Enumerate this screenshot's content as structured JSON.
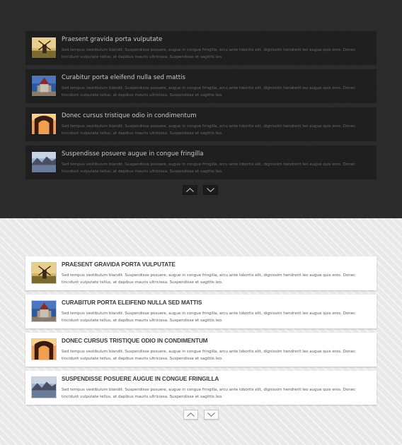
{
  "dark_list": {
    "items": [
      {
        "title": "Praesent gravida porta vulputate",
        "description": "Sed tempus vestibulum blandit. Suspendisse posuere, augue in congue fringilla, arcu ante lobortis elit, dignissim hendrerit leo augue quis eros. Donec tincidunt vulputate tellus, at dapibus mauris ultriciesa. Suspendisse et sagittis leo.",
        "image": "windmill"
      },
      {
        "title": "Curabitur porta eleifend nulla sed mattis",
        "description": "Sed tempus vestibulum blandit. Suspendisse posuere, augue in congue fringilla, arcu ante lobortis elit, dignissim hendrerit leo augue quis eros. Donec tincidunt vulputate tellus, at dapibus mauris ultriciesa. Suspendisse et sagittis leo.",
        "image": "castle"
      },
      {
        "title": "Donec cursus tristique odio in condimentum",
        "description": "Sed tempus vestibulum blandit. Suspendisse posuere, augue in congue fringilla, arcu ante lobortis elit, dignissim hendrerit leo augue quis eros. Donec tincidunt vulputate tellus, at dapibus mauris ultriciesa. Suspendisse et sagittis leo.",
        "image": "arch"
      },
      {
        "title": "Suspendisse posuere augue in congue fringilla",
        "description": "Sed tempus vestibulum blandit. Suspendisse posuere, augue in congue fringilla, arcu ante lobortis elit, dignissim hendrerit leo augue quis eros. Donec tincidunt vulputate tellus, at dapibus mauris ultriciesa. Suspendisse et sagittis leo.",
        "image": "lake"
      }
    ],
    "nav": {
      "up_icon": "chevron-up-icon",
      "down_icon": "chevron-down-icon"
    }
  },
  "light_list": {
    "items": [
      {
        "title": "Praesent gravida porta vulputate",
        "description": "Sed tempus vestibulum blandit. Suspendisse posuere, augue in congue fringilla, arcu ante lobortis elit, dignissim hendrerit leo augue quis eros. Donec tincidunt vulputate tellus, at dapibus mauris ultriciesa. Suspendisse et sagittis leo.",
        "image": "windmill"
      },
      {
        "title": "Curabitur porta eleifend nulla sed mattis",
        "description": "Sed tempus vestibulum blandit. Suspendisse posuere, augue in congue fringilla, arcu ante lobortis elit, dignissim hendrerit leo augue quis eros. Donec tincidunt vulputate tellus, at dapibus mauris ultriciesa. Suspendisse et sagittis leo.",
        "image": "castle"
      },
      {
        "title": "Donec cursus tristique odio in condimentum",
        "description": "Sed tempus vestibulum blandit. Suspendisse posuere, augue in congue fringilla, arcu ante lobortis elit, dignissim hendrerit leo augue quis eros. Donec tincidunt vulputate tellus, at dapibus mauris ultriciesa. Suspendisse et sagittis leo.",
        "image": "arch"
      },
      {
        "title": "Suspendisse posuere augue in congue fringilla",
        "description": "Sed tempus vestibulum blandit. Suspendisse posuere, augue in congue fringilla, arcu ante lobortis elit, dignissim hendrerit leo augue quis eros. Donec tincidunt vulputate tellus, at dapibus mauris ultriciesa. Suspendisse et sagittis leo.",
        "image": "lake"
      }
    ],
    "nav": {
      "up_icon": "chevron-up-icon",
      "down_icon": "chevron-down-icon"
    }
  },
  "colors": {
    "dark_background": "#2a2a2a",
    "dark_item": "#1f1f1f",
    "light_background": "#e9e9e9",
    "light_item": "#ffffff"
  }
}
